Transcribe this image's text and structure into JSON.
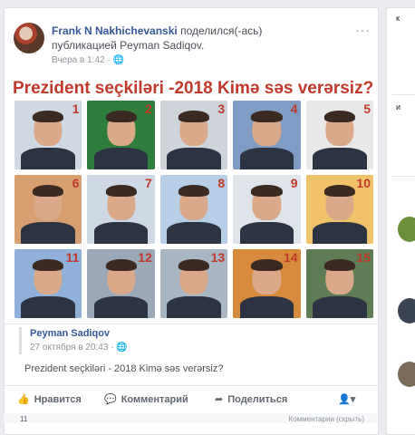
{
  "post": {
    "author_name": "Frank N Nakhichevanski",
    "shared_text": " поделился(-ась)",
    "shared_line2": "публикацией Peyman Sadiqov.",
    "time": "Вчера в 1:42 · ",
    "privacy_icon": "globe-icon",
    "menu_icon": "more-dots-icon",
    "menu": "···",
    "image_title": "Prezident seçkiləri -2018  Kimə səs verərsiz?",
    "candidates": [
      "1",
      "2",
      "3",
      "4",
      "5",
      "6",
      "7",
      "8",
      "9",
      "10",
      "11",
      "12",
      "13",
      "14",
      "15"
    ]
  },
  "original": {
    "author": "Peyman Sadiqov",
    "meta": "27 октября в 20:43 · ",
    "text": "Prezident seçkiləri - 2018 Kimə səs verərsiz?"
  },
  "actions": {
    "like": "Нравится",
    "comment": "Комментарий",
    "share": "Поделиться"
  },
  "bottom": {
    "left": "11",
    "right": "Комментарии (скрыть)"
  },
  "right_panel": {
    "item1": "к",
    "item2": "и"
  },
  "colors": {
    "link": "#365899",
    "title_red": "#c0392b",
    "background": "#e9ebee"
  }
}
